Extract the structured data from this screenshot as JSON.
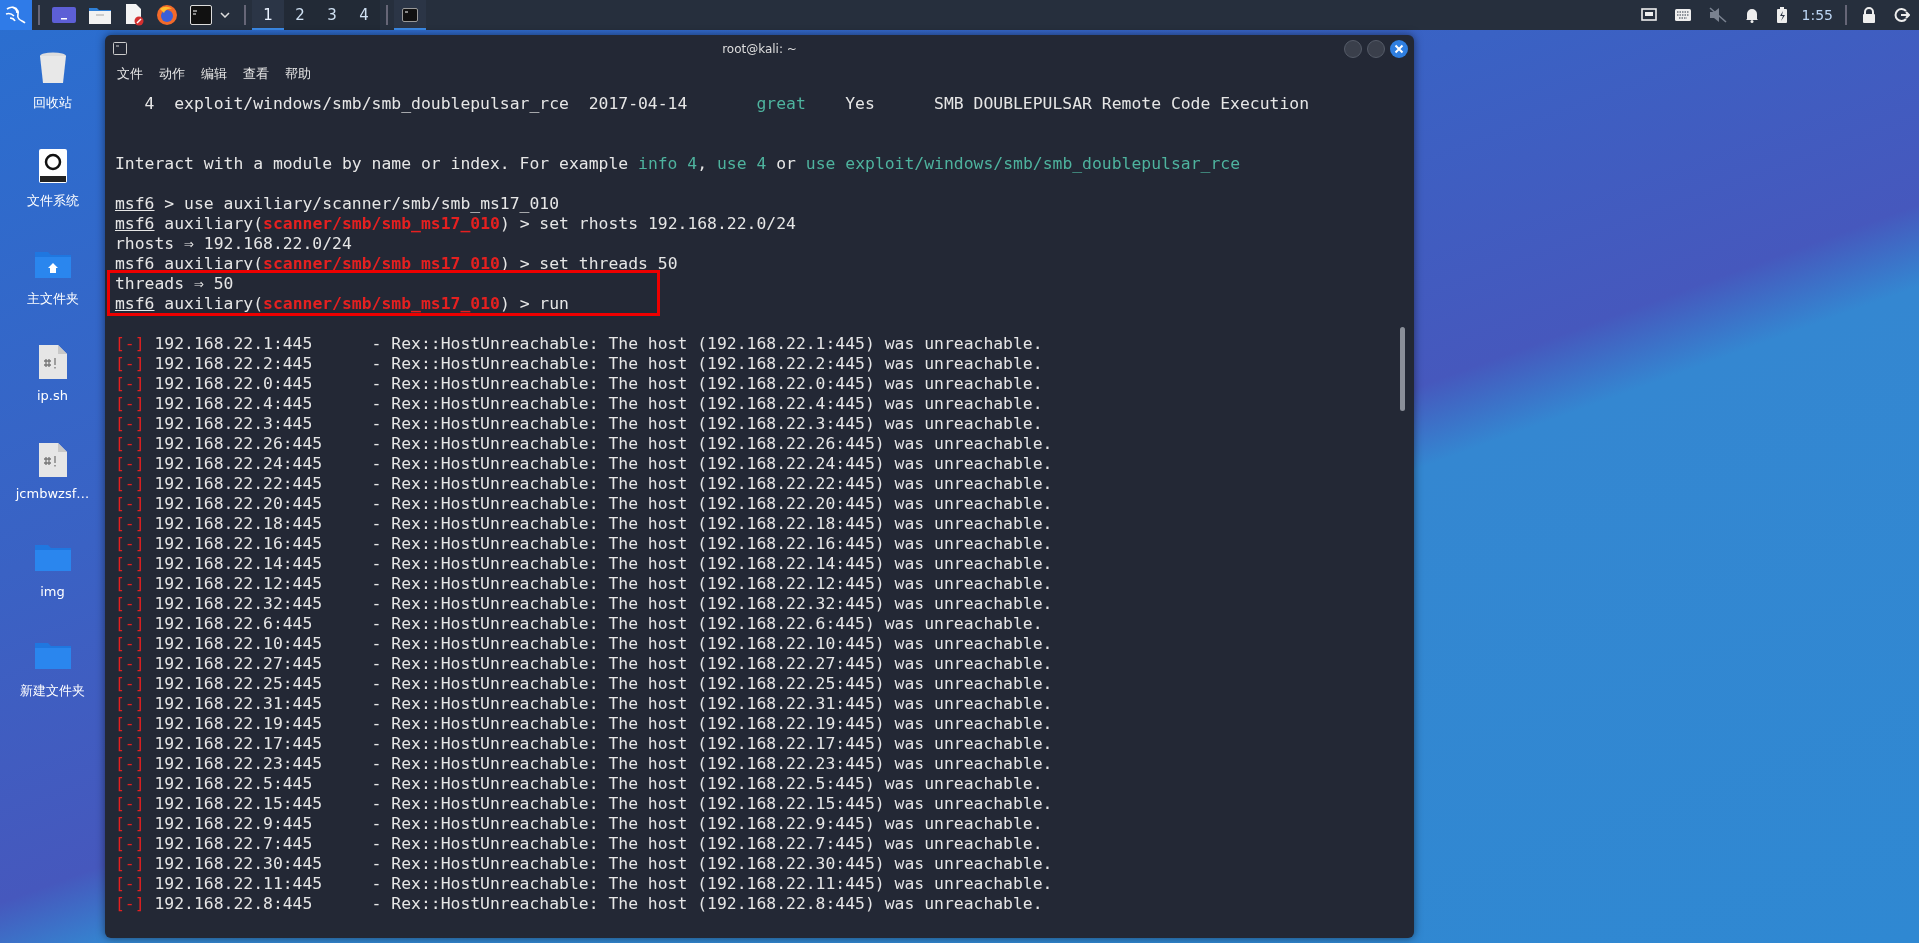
{
  "taskbar": {
    "workspaces": [
      {
        "label": "1",
        "selected": true
      },
      {
        "label": "2",
        "selected": false
      },
      {
        "label": "3",
        "selected": false
      },
      {
        "label": "4",
        "selected": false
      }
    ],
    "clock": "1:55"
  },
  "desktop_icons": [
    {
      "label": "回收站",
      "kind": "trash"
    },
    {
      "label": "文件系统",
      "kind": "drive"
    },
    {
      "label": "主文件夹",
      "kind": "home"
    },
    {
      "label": "ip.sh",
      "kind": "script"
    },
    {
      "label": "jcmbwzsf…",
      "kind": "script"
    },
    {
      "label": "img",
      "kind": "folder"
    },
    {
      "label": "新建文件夹",
      "kind": "folder"
    }
  ],
  "window": {
    "title": "root@kali: ~",
    "menu": [
      "文件",
      "动作",
      "编辑",
      "查看",
      "帮助"
    ]
  },
  "terminal": {
    "lines": [
      {
        "kind": "text",
        "segments": [
          {
            "text": "   4  exploit/windows/smb/smb_doublepulsar_rce  2017-04-14       ",
            "kind": "plain"
          },
          {
            "text": "great",
            "kind": "accent"
          },
          {
            "text": "    Yes      SMB DOUBLEPULSAR Remote Code Execution",
            "kind": "plain"
          }
        ]
      },
      {
        "kind": "blank"
      },
      {
        "kind": "blank"
      },
      {
        "kind": "text",
        "segments": [
          {
            "text": "Interact with a module by name or index. For example ",
            "kind": "plain"
          },
          {
            "text": "info 4",
            "kind": "accent"
          },
          {
            "text": ", ",
            "kind": "plain"
          },
          {
            "text": "use 4",
            "kind": "accent"
          },
          {
            "text": " or ",
            "kind": "plain"
          },
          {
            "text": "use exploit/windows/smb/smb_doublepulsar_rce",
            "kind": "accent"
          }
        ]
      },
      {
        "kind": "blank"
      },
      {
        "kind": "text",
        "segments": [
          {
            "text": "msf6",
            "kind": "prompt"
          },
          {
            "text": " > use auxiliary/scanner/smb/smb_ms17_010",
            "kind": "plain"
          }
        ]
      },
      {
        "kind": "text",
        "segments": [
          {
            "text": "msf6",
            "kind": "prompt"
          },
          {
            "text": " auxiliary(",
            "kind": "plain"
          },
          {
            "text": "scanner/smb/smb_ms17_010",
            "kind": "module"
          },
          {
            "text": ") > set rhosts 192.168.22.0/24",
            "kind": "plain"
          }
        ]
      },
      {
        "kind": "text",
        "segments": [
          {
            "text": "rhosts ⇒ 192.168.22.0/24",
            "kind": "plain"
          }
        ]
      },
      {
        "kind": "text",
        "segments": [
          {
            "text": "msf6",
            "kind": "prompt"
          },
          {
            "text": " auxiliary(",
            "kind": "plain"
          },
          {
            "text": "scanner/smb/smb_ms17_010",
            "kind": "module"
          },
          {
            "text": ") > set threads 50",
            "kind": "plain"
          }
        ]
      },
      {
        "kind": "text",
        "segments": [
          {
            "text": "threads ⇒ 50",
            "kind": "plain"
          }
        ]
      },
      {
        "kind": "text",
        "segments": [
          {
            "text": "msf6",
            "kind": "prompt"
          },
          {
            "text": " auxiliary(",
            "kind": "plain"
          },
          {
            "text": "scanner/smb/smb_ms17_010",
            "kind": "module"
          },
          {
            "text": ") > run",
            "kind": "plain"
          }
        ]
      },
      {
        "kind": "blank"
      }
    ],
    "results": [
      {
        "marker": "[-]",
        "text": "192.168.22.1:445      - Rex::HostUnreachable: The host (192.168.22.1:445) was unreachable."
      },
      {
        "marker": "[-]",
        "text": "192.168.22.2:445      - Rex::HostUnreachable: The host (192.168.22.2:445) was unreachable."
      },
      {
        "marker": "[-]",
        "text": "192.168.22.0:445      - Rex::HostUnreachable: The host (192.168.22.0:445) was unreachable."
      },
      {
        "marker": "[-]",
        "text": "192.168.22.4:445      - Rex::HostUnreachable: The host (192.168.22.4:445) was unreachable."
      },
      {
        "marker": "[-]",
        "text": "192.168.22.3:445      - Rex::HostUnreachable: The host (192.168.22.3:445) was unreachable."
      },
      {
        "marker": "[-]",
        "text": "192.168.22.26:445     - Rex::HostUnreachable: The host (192.168.22.26:445) was unreachable."
      },
      {
        "marker": "[-]",
        "text": "192.168.22.24:445     - Rex::HostUnreachable: The host (192.168.22.24:445) was unreachable."
      },
      {
        "marker": "[-]",
        "text": "192.168.22.22:445     - Rex::HostUnreachable: The host (192.168.22.22:445) was unreachable."
      },
      {
        "marker": "[-]",
        "text": "192.168.22.20:445     - Rex::HostUnreachable: The host (192.168.22.20:445) was unreachable."
      },
      {
        "marker": "[-]",
        "text": "192.168.22.18:445     - Rex::HostUnreachable: The host (192.168.22.18:445) was unreachable."
      },
      {
        "marker": "[-]",
        "text": "192.168.22.16:445     - Rex::HostUnreachable: The host (192.168.22.16:445) was unreachable."
      },
      {
        "marker": "[-]",
        "text": "192.168.22.14:445     - Rex::HostUnreachable: The host (192.168.22.14:445) was unreachable."
      },
      {
        "marker": "[-]",
        "text": "192.168.22.12:445     - Rex::HostUnreachable: The host (192.168.22.12:445) was unreachable."
      },
      {
        "marker": "[-]",
        "text": "192.168.22.32:445     - Rex::HostUnreachable: The host (192.168.22.32:445) was unreachable."
      },
      {
        "marker": "[-]",
        "text": "192.168.22.6:445      - Rex::HostUnreachable: The host (192.168.22.6:445) was unreachable."
      },
      {
        "marker": "[-]",
        "text": "192.168.22.10:445     - Rex::HostUnreachable: The host (192.168.22.10:445) was unreachable."
      },
      {
        "marker": "[-]",
        "text": "192.168.22.27:445     - Rex::HostUnreachable: The host (192.168.22.27:445) was unreachable."
      },
      {
        "marker": "[-]",
        "text": "192.168.22.25:445     - Rex::HostUnreachable: The host (192.168.22.25:445) was unreachable."
      },
      {
        "marker": "[-]",
        "text": "192.168.22.31:445     - Rex::HostUnreachable: The host (192.168.22.31:445) was unreachable."
      },
      {
        "marker": "[-]",
        "text": "192.168.22.19:445     - Rex::HostUnreachable: The host (192.168.22.19:445) was unreachable."
      },
      {
        "marker": "[-]",
        "text": "192.168.22.17:445     - Rex::HostUnreachable: The host (192.168.22.17:445) was unreachable."
      },
      {
        "marker": "[-]",
        "text": "192.168.22.23:445     - Rex::HostUnreachable: The host (192.168.22.23:445) was unreachable."
      },
      {
        "marker": "[-]",
        "text": "192.168.22.5:445      - Rex::HostUnreachable: The host (192.168.22.5:445) was unreachable."
      },
      {
        "marker": "[-]",
        "text": "192.168.22.15:445     - Rex::HostUnreachable: The host (192.168.22.15:445) was unreachable."
      },
      {
        "marker": "[-]",
        "text": "192.168.22.9:445      - Rex::HostUnreachable: The host (192.168.22.9:445) was unreachable."
      },
      {
        "marker": "[-]",
        "text": "192.168.22.7:445      - Rex::HostUnreachable: The host (192.168.22.7:445) was unreachable."
      },
      {
        "marker": "[-]",
        "text": "192.168.22.30:445     - Rex::HostUnreachable: The host (192.168.22.30:445) was unreachable."
      },
      {
        "marker": "[-]",
        "text": "192.168.22.11:445     - Rex::HostUnreachable: The host (192.168.22.11:445) was unreachable."
      },
      {
        "marker": "[-]",
        "text": "192.168.22.8:445      - Rex::HostUnreachable: The host (192.168.22.8:445) was unreachable."
      }
    ]
  }
}
